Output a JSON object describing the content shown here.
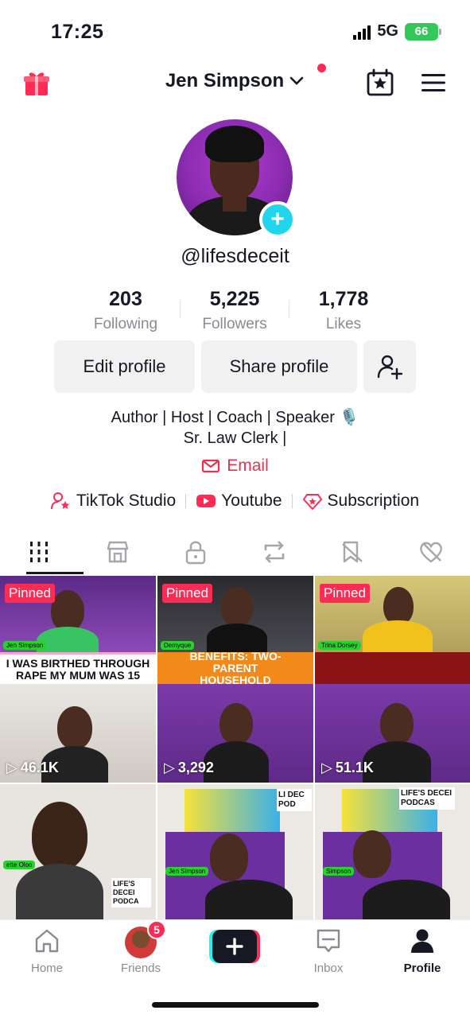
{
  "status_bar": {
    "time": "17:25",
    "network": "5G",
    "battery": "66"
  },
  "header": {
    "title": "Jen Simpson"
  },
  "profile": {
    "username": "@lifesdeceit",
    "stats": [
      {
        "value": "203",
        "label": "Following"
      },
      {
        "value": "5,225",
        "label": "Followers"
      },
      {
        "value": "1,778",
        "label": "Likes"
      }
    ]
  },
  "actions": {
    "edit": "Edit profile",
    "share": "Share profile"
  },
  "bio": {
    "line1": "Author | Host | Coach | Speaker 🎙️",
    "line2": "Sr. Law Clerk |",
    "email": "Email"
  },
  "links": [
    {
      "label": "TikTok Studio",
      "icon": "person-star-icon"
    },
    {
      "label": "Youtube",
      "icon": "youtube-icon"
    },
    {
      "label": "Subscription",
      "icon": "subscription-icon"
    }
  ],
  "tabs": [
    "videos",
    "shop",
    "private",
    "reposts",
    "favorites",
    "liked"
  ],
  "videos": [
    {
      "pinned": "Pinned",
      "name_tag": "Jen Simpson",
      "caption": "I WAS BIRTHED THROUGH RAPE MY MUM WAS 15",
      "views": "46.1K"
    },
    {
      "pinned": "Pinned",
      "name_tag": "Demyque",
      "caption": "BENEFITS: TWO-PARENT HOUSEHOLD",
      "views": "3,292"
    },
    {
      "pinned": "Pinned",
      "name_tag": "Trina Dorsey",
      "caption": "",
      "views": "51.1K"
    },
    {
      "name_tag": "ette Oloo",
      "overlay": "LIFE'S DECEI PODCA"
    },
    {
      "name_tag": "Jen Simpson",
      "overlay": "LI DEC POD"
    },
    {
      "name_tag": "Simpson",
      "overlay": "LIFE'S DECEI PODCAS"
    }
  ],
  "bottom_nav": {
    "home": "Home",
    "friends": "Friends",
    "friends_badge": "5",
    "inbox": "Inbox",
    "profile": "Profile"
  },
  "colors": {
    "accent": "#fe2c55",
    "teal": "#20d5ec",
    "email": "#e8324f"
  }
}
